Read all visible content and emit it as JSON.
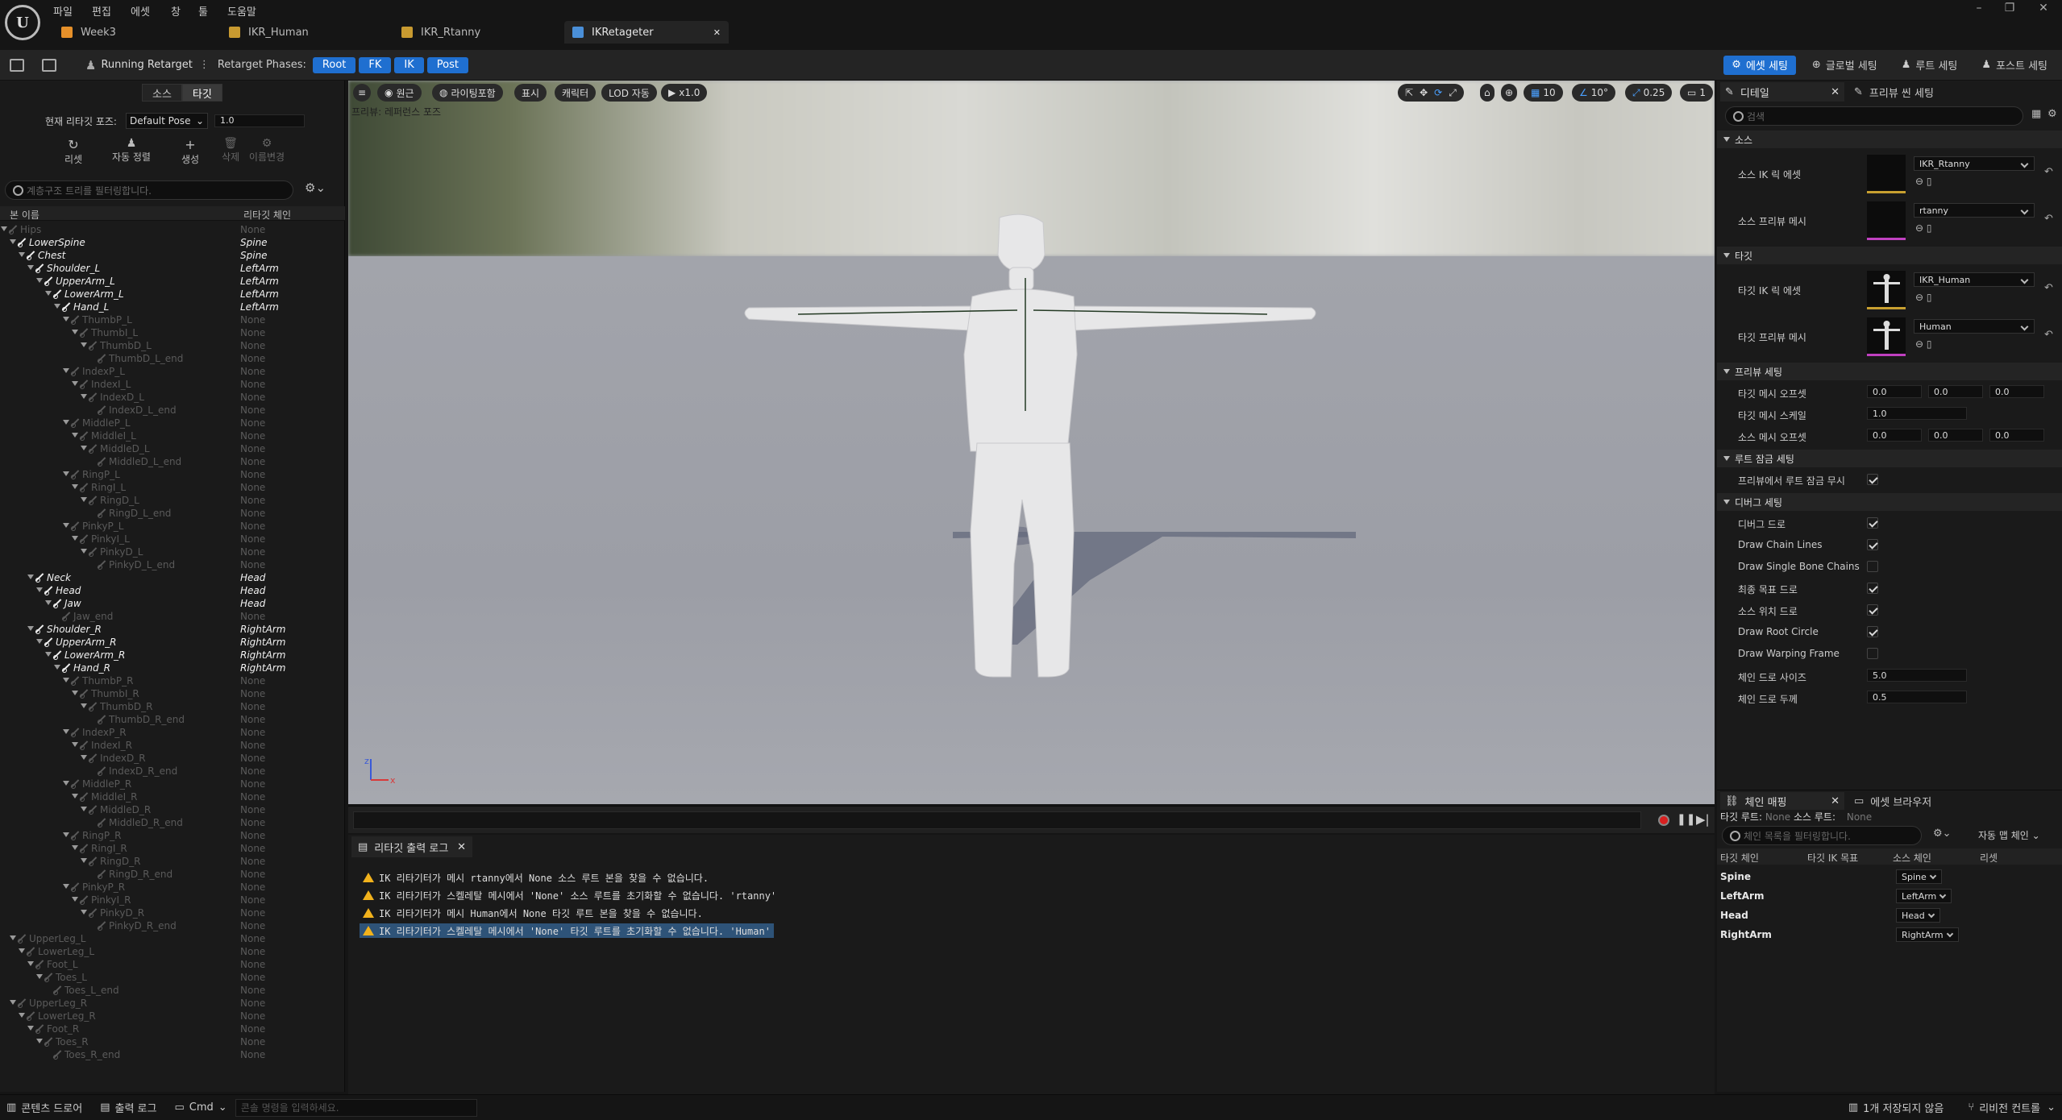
{
  "menu": [
    "파일",
    "편집",
    "에셋",
    "창",
    "툴",
    "도움말"
  ],
  "tabs": [
    {
      "label": "Week3",
      "color": "#e6902a"
    },
    {
      "label": "IKR_Human",
      "color": "#c89a30"
    },
    {
      "label": "IKR_Rtanny",
      "color": "#c89a30"
    },
    {
      "label": "IKRetageter",
      "color": "#4a8fd8"
    }
  ],
  "toolbar": {
    "running_label": "Running Retarget",
    "phases_label": "Retarget Phases:",
    "phases": [
      "Root",
      "FK",
      "IK",
      "Post"
    ],
    "right_buttons": [
      "에셋 세팅",
      "글로벌 세팅",
      "루트 세팅",
      "포스트 세팅"
    ]
  },
  "left": {
    "seg": [
      "소스",
      "타깃"
    ],
    "pose_label": "현재 리타깃 포즈:",
    "pose_value": "Default Pose",
    "pose_blend": "1.0",
    "actions": [
      "리셋",
      "자동 정렬",
      "생성",
      "삭제",
      "이름변경"
    ],
    "search_placeholder": "계층구조 트리를 필터링합니다.",
    "col_bone": "본 이름",
    "col_chain": "리타깃 체인",
    "bones": [
      {
        "n": "Hips",
        "c": "None",
        "d": 0,
        "dim": true
      },
      {
        "n": "LowerSpine",
        "c": "Spine",
        "d": 1
      },
      {
        "n": "Chest",
        "c": "Spine",
        "d": 2
      },
      {
        "n": "Shoulder_L",
        "c": "LeftArm",
        "d": 3
      },
      {
        "n": "UpperArm_L",
        "c": "LeftArm",
        "d": 4
      },
      {
        "n": "LowerArm_L",
        "c": "LeftArm",
        "d": 5
      },
      {
        "n": "Hand_L",
        "c": "LeftArm",
        "d": 6
      },
      {
        "n": "ThumbP_L",
        "c": "None",
        "d": 7,
        "dim": true
      },
      {
        "n": "ThumbI_L",
        "c": "None",
        "d": 8,
        "dim": true
      },
      {
        "n": "ThumbD_L",
        "c": "None",
        "d": 9,
        "dim": true
      },
      {
        "n": "ThumbD_L_end",
        "c": "None",
        "d": 10,
        "dim": true
      },
      {
        "n": "IndexP_L",
        "c": "None",
        "d": 7,
        "dim": true
      },
      {
        "n": "IndexI_L",
        "c": "None",
        "d": 8,
        "dim": true
      },
      {
        "n": "IndexD_L",
        "c": "None",
        "d": 9,
        "dim": true
      },
      {
        "n": "IndexD_L_end",
        "c": "None",
        "d": 10,
        "dim": true
      },
      {
        "n": "MiddleP_L",
        "c": "None",
        "d": 7,
        "dim": true
      },
      {
        "n": "MiddleI_L",
        "c": "None",
        "d": 8,
        "dim": true
      },
      {
        "n": "MiddleD_L",
        "c": "None",
        "d": 9,
        "dim": true
      },
      {
        "n": "MiddleD_L_end",
        "c": "None",
        "d": 10,
        "dim": true
      },
      {
        "n": "RingP_L",
        "c": "None",
        "d": 7,
        "dim": true
      },
      {
        "n": "RingI_L",
        "c": "None",
        "d": 8,
        "dim": true
      },
      {
        "n": "RingD_L",
        "c": "None",
        "d": 9,
        "dim": true
      },
      {
        "n": "RingD_L_end",
        "c": "None",
        "d": 10,
        "dim": true
      },
      {
        "n": "PinkyP_L",
        "c": "None",
        "d": 7,
        "dim": true
      },
      {
        "n": "PinkyI_L",
        "c": "None",
        "d": 8,
        "dim": true
      },
      {
        "n": "PinkyD_L",
        "c": "None",
        "d": 9,
        "dim": true
      },
      {
        "n": "PinkyD_L_end",
        "c": "None",
        "d": 10,
        "dim": true
      },
      {
        "n": "Neck",
        "c": "Head",
        "d": 3
      },
      {
        "n": "Head",
        "c": "Head",
        "d": 4
      },
      {
        "n": "Jaw",
        "c": "Head",
        "d": 5
      },
      {
        "n": "Jaw_end",
        "c": "None",
        "d": 6,
        "dim": true
      },
      {
        "n": "Shoulder_R",
        "c": "RightArm",
        "d": 3
      },
      {
        "n": "UpperArm_R",
        "c": "RightArm",
        "d": 4
      },
      {
        "n": "LowerArm_R",
        "c": "RightArm",
        "d": 5
      },
      {
        "n": "Hand_R",
        "c": "RightArm",
        "d": 6
      },
      {
        "n": "ThumbP_R",
        "c": "None",
        "d": 7,
        "dim": true
      },
      {
        "n": "ThumbI_R",
        "c": "None",
        "d": 8,
        "dim": true
      },
      {
        "n": "ThumbD_R",
        "c": "None",
        "d": 9,
        "dim": true
      },
      {
        "n": "ThumbD_R_end",
        "c": "None",
        "d": 10,
        "dim": true
      },
      {
        "n": "IndexP_R",
        "c": "None",
        "d": 7,
        "dim": true
      },
      {
        "n": "IndexI_R",
        "c": "None",
        "d": 8,
        "dim": true
      },
      {
        "n": "IndexD_R",
        "c": "None",
        "d": 9,
        "dim": true
      },
      {
        "n": "IndexD_R_end",
        "c": "None",
        "d": 10,
        "dim": true
      },
      {
        "n": "MiddleP_R",
        "c": "None",
        "d": 7,
        "dim": true
      },
      {
        "n": "MiddleI_R",
        "c": "None",
        "d": 8,
        "dim": true
      },
      {
        "n": "MiddleD_R",
        "c": "None",
        "d": 9,
        "dim": true
      },
      {
        "n": "MiddleD_R_end",
        "c": "None",
        "d": 10,
        "dim": true
      },
      {
        "n": "RingP_R",
        "c": "None",
        "d": 7,
        "dim": true
      },
      {
        "n": "RingI_R",
        "c": "None",
        "d": 8,
        "dim": true
      },
      {
        "n": "RingD_R",
        "c": "None",
        "d": 9,
        "dim": true
      },
      {
        "n": "RingD_R_end",
        "c": "None",
        "d": 10,
        "dim": true
      },
      {
        "n": "PinkyP_R",
        "c": "None",
        "d": 7,
        "dim": true
      },
      {
        "n": "PinkyI_R",
        "c": "None",
        "d": 8,
        "dim": true
      },
      {
        "n": "PinkyD_R",
        "c": "None",
        "d": 9,
        "dim": true
      },
      {
        "n": "PinkyD_R_end",
        "c": "None",
        "d": 10,
        "dim": true
      },
      {
        "n": "UpperLeg_L",
        "c": "None",
        "d": 1,
        "dim": true
      },
      {
        "n": "LowerLeg_L",
        "c": "None",
        "d": 2,
        "dim": true
      },
      {
        "n": "Foot_L",
        "c": "None",
        "d": 3,
        "dim": true
      },
      {
        "n": "Toes_L",
        "c": "None",
        "d": 4,
        "dim": true
      },
      {
        "n": "Toes_L_end",
        "c": "None",
        "d": 5,
        "dim": true
      },
      {
        "n": "UpperLeg_R",
        "c": "None",
        "d": 1,
        "dim": true
      },
      {
        "n": "LowerLeg_R",
        "c": "None",
        "d": 2,
        "dim": true
      },
      {
        "n": "Foot_R",
        "c": "None",
        "d": 3,
        "dim": true
      },
      {
        "n": "Toes_R",
        "c": "None",
        "d": 4,
        "dim": true
      },
      {
        "n": "Toes_R_end",
        "c": "None",
        "d": 5,
        "dim": true
      }
    ]
  },
  "viewport": {
    "buttons": [
      "원근",
      "라이팅포함",
      "표시",
      "캐릭터",
      "LOD 자동",
      "x1.0"
    ],
    "preview_label": "프리뷰: 레퍼런스 포즈",
    "right_values": [
      "10",
      "10°",
      "0.25",
      "1"
    ],
    "axis_z": "z",
    "axis_x": "x"
  },
  "log": {
    "tab": "리타깃 출력 로그",
    "lines": [
      "IK 리타기터가 메시 rtanny에서 None 소스 루트 본을 찾을 수 없습니다.",
      "IK 리타기터가 스켈레탈 메시에서 'None' 소스 루트를 초기화할 수 없습니다. 'rtanny'",
      "IK 리타기터가 메시 Human에서 None 타깃 루트 본을 찾을 수 없습니다.",
      "IK 리타기터가 스켈레탈 메시에서 'None' 타깃 루트를 초기화할 수 없습니다. 'Human'"
    ]
  },
  "details": {
    "tab1": "디테일",
    "tab2": "프리뷰 씬 세팅",
    "search_placeholder": "검색",
    "sec_source": "소스",
    "src_ik_label": "소스 IK 릭 에셋",
    "src_ik_value": "IKR_Rtanny",
    "src_mesh_label": "소스 프리뷰 메시",
    "src_mesh_value": "rtanny",
    "sec_target": "타깃",
    "tgt_ik_label": "타깃 IK 릭 에셋",
    "tgt_ik_value": "IKR_Human",
    "tgt_mesh_label": "타깃 프리뷰 메시",
    "tgt_mesh_value": "Human",
    "sec_preview": "프리뷰 세팅",
    "tgt_offset_label": "타깃 메시 오프셋",
    "tgt_offset": [
      "0.0",
      "0.0",
      "0.0"
    ],
    "tgt_scale_label": "타깃 메시 스케일",
    "tgt_scale": "1.0",
    "src_offset_label": "소스 메시 오프셋",
    "src_offset": [
      "0.0",
      "0.0",
      "0.0"
    ],
    "sec_rootlock": "루트 잠금 세팅",
    "rootlock_label": "프리뷰에서 루트 잠금 무시",
    "sec_debug": "디버그 세팅",
    "debug_items": [
      {
        "label": "디버그 드로",
        "on": true
      },
      {
        "label": "Draw Chain Lines",
        "on": true
      },
      {
        "label": "Draw Single Bone Chains",
        "on": false
      },
      {
        "label": "최종 목표 드로",
        "on": true
      },
      {
        "label": "소스 위치 드로",
        "on": true
      },
      {
        "label": "Draw Root Circle",
        "on": true
      },
      {
        "label": "Draw Warping Frame",
        "on": false
      }
    ],
    "chain_size_label": "체인 드로 사이즈",
    "chain_size": "5.0",
    "chain_thick_label": "체인 드로 두께",
    "chain_thick": "0.5"
  },
  "chain": {
    "tab1": "체인 매핑",
    "tab2": "에셋 브라우저",
    "root_text": "타깃 루트:",
    "root_val": "None",
    "src_root_text": "소스 루트:",
    "src_root_val": "None",
    "search_placeholder": "체인 목록을 필터링합니다.",
    "auto_map": "자동 맵 체인",
    "cols": [
      "타깃 체인",
      "타깃 IK 목표",
      "소스 체인",
      "리셋"
    ],
    "rows": [
      {
        "target": "Spine",
        "source": "Spine"
      },
      {
        "target": "LeftArm",
        "source": "LeftArm"
      },
      {
        "target": "Head",
        "source": "Head"
      },
      {
        "target": "RightArm",
        "source": "RightArm"
      }
    ]
  },
  "status": {
    "content_drawer": "콘텐츠 드로어",
    "output_log": "출력 로그",
    "cmd": "Cmd",
    "console_placeholder": "콘솔 명령을 입력하세요.",
    "unsaved": "1개 저장되지 않음",
    "revision": "리비전 컨트롤"
  }
}
